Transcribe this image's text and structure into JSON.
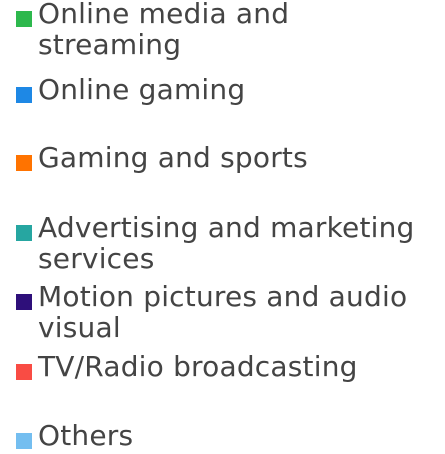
{
  "chart_data": {
    "type": "pie",
    "legend_position": "right",
    "series": [
      {
        "name": "Online media and streaming",
        "color": "#2DB84D"
      },
      {
        "name": "Online gaming",
        "color": "#1E88E5"
      },
      {
        "name": "Gaming and sports",
        "color": "#FF7300"
      },
      {
        "name": "Advertising and marketing services",
        "color": "#26A6A1"
      },
      {
        "name": "Motion pictures and audio visual",
        "color": "#2E0F7A"
      },
      {
        "name": "TV/Radio broadcasting",
        "color": "#F94C44"
      },
      {
        "name": "Others",
        "color": "#74BEF0"
      }
    ]
  }
}
